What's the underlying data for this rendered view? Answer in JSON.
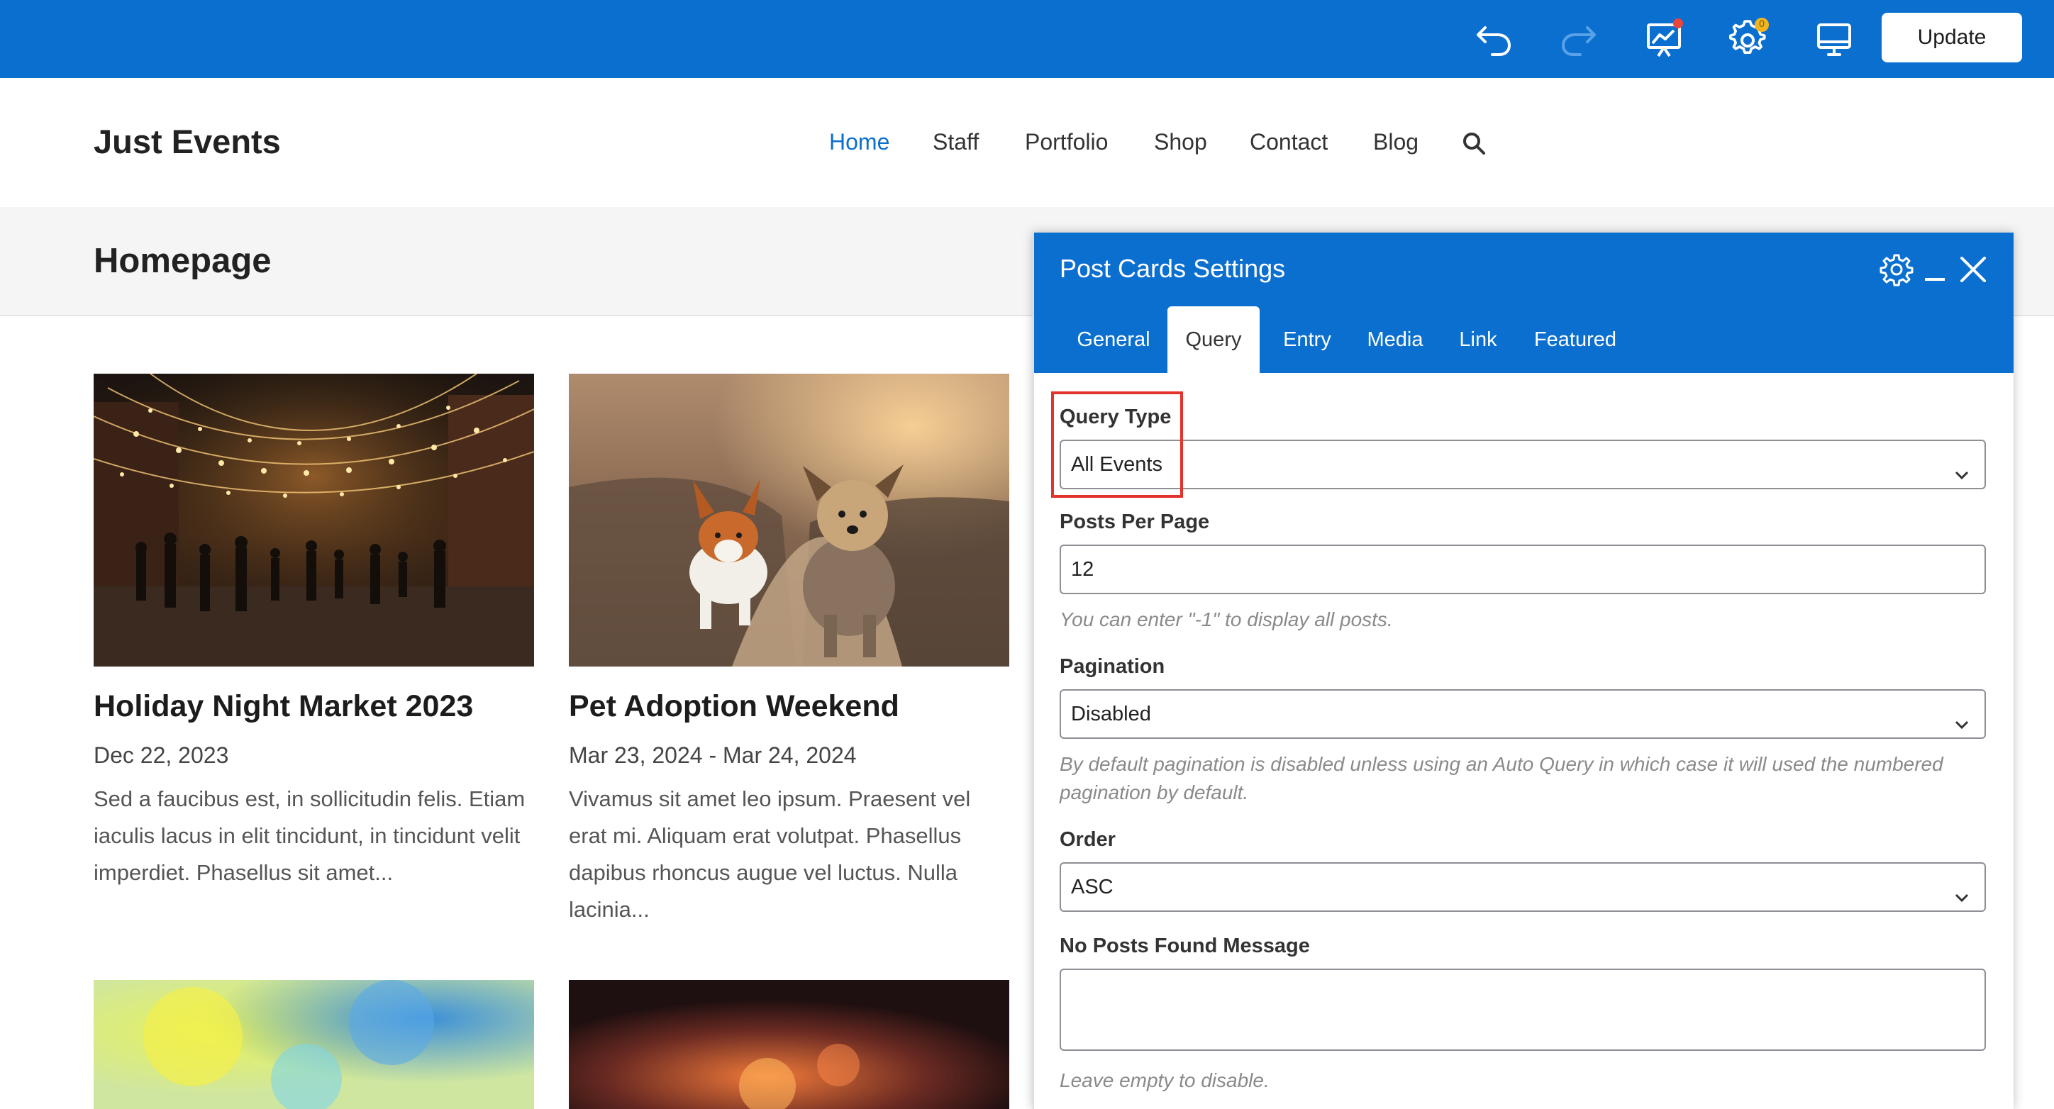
{
  "toolbar": {
    "icons": [
      "undo-icon",
      "redo-icon",
      "analytics-icon",
      "settings-icon",
      "desktop-preview-icon"
    ],
    "notification_badge": "0",
    "update_label": "Update",
    "accent_color": "#0b6fcf"
  },
  "site": {
    "title": "Just Events",
    "nav": [
      "Home",
      "Staff",
      "Portfolio",
      "Shop",
      "Contact",
      "Blog"
    ],
    "active_nav": "Home"
  },
  "page": {
    "title": "Homepage"
  },
  "cards": [
    {
      "title": "Holiday Night Market 2023",
      "date": "Dec 22, 2023",
      "excerpt": "Sed a faucibus est, in sollicitudin felis. Etiam iaculis lacus in elit tincidunt, in tincidunt velit imperdiet. Phasellus sit amet..."
    },
    {
      "title": "Pet Adoption Weekend",
      "date": "Mar 23, 2024 - Mar 24, 2024",
      "excerpt": "Vivamus sit amet leo ipsum. Praesent vel erat mi. Aliquam erat volutpat. Phasellus dapibus rhoncus augue vel luctus. Nulla lacinia..."
    }
  ],
  "panel": {
    "title": "Post Cards Settings",
    "tabs": [
      "General",
      "Query",
      "Entry",
      "Media",
      "Link",
      "Featured"
    ],
    "active_tab": "Query",
    "fields": {
      "query_type": {
        "label": "Query Type",
        "value": "All Events"
      },
      "posts_per_page": {
        "label": "Posts Per Page",
        "value": "12",
        "help": "You can enter \"-1\" to display all posts."
      },
      "pagination": {
        "label": "Pagination",
        "value": "Disabled",
        "help": "By default pagination is disabled unless using an Auto Query in which case it will used the numbered pagination by default."
      },
      "order": {
        "label": "Order",
        "value": "ASC"
      },
      "no_posts_message": {
        "label": "No Posts Found Message",
        "value": "",
        "help": "Leave empty to disable."
      }
    }
  }
}
